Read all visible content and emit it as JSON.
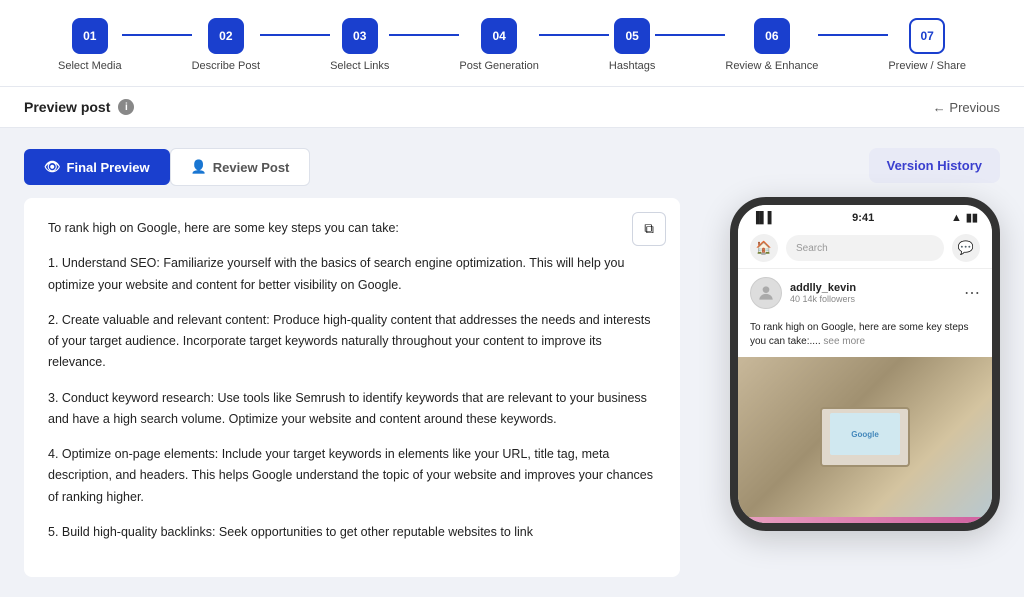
{
  "stepper": {
    "steps": [
      {
        "number": "01",
        "label": "Select Media",
        "state": "filled"
      },
      {
        "number": "02",
        "label": "Describe Post",
        "state": "filled"
      },
      {
        "number": "03",
        "label": "Select Links",
        "state": "filled"
      },
      {
        "number": "04",
        "label": "Post Generation",
        "state": "filled"
      },
      {
        "number": "05",
        "label": "Hashtags",
        "state": "filled"
      },
      {
        "number": "06",
        "label": "Review & Enhance",
        "state": "filled"
      },
      {
        "number": "07",
        "label": "Preview / Share",
        "state": "outline"
      }
    ]
  },
  "header": {
    "preview_post_label": "Preview post",
    "previous_btn": "← Previous"
  },
  "tabs": {
    "final_preview": "Final Preview",
    "review_post": "Review Post"
  },
  "version_history_btn": "Version History",
  "copy_icon": "⧉",
  "content": {
    "paragraphs": [
      "To rank high on Google, here are some key steps you can take:",
      "1. Understand SEO: Familiarize yourself with the basics of search engine optimization. This will help you optimize your website and content for better visibility on Google.",
      "2. Create valuable and relevant content: Produce high-quality content that addresses the needs and interests of your target audience. Incorporate target keywords naturally throughout your content to improve its relevance.",
      "3. Conduct keyword research: Use tools like Semrush to identify keywords that are relevant to your business and have a high search volume. Optimize your website and content around these keywords.",
      "4. Optimize on-page elements: Include your target keywords in elements like your URL, title tag, meta description, and headers. This helps Google understand the topic of your website and improves your chances of ranking higher.",
      "5. Build high-quality backlinks: Seek opportunities to get other reputable websites to link"
    ]
  },
  "phone": {
    "time": "9:41",
    "username": "addlly_kevin",
    "followers": "40 14k followers",
    "caption_short": "To rank high on Google, here are some key steps you can take:....",
    "see_more": "see more",
    "search_placeholder": "Search",
    "google_screen_text": "Google"
  },
  "colors": {
    "accent": "#1a3fce",
    "accent_light": "#e8eaf6"
  }
}
